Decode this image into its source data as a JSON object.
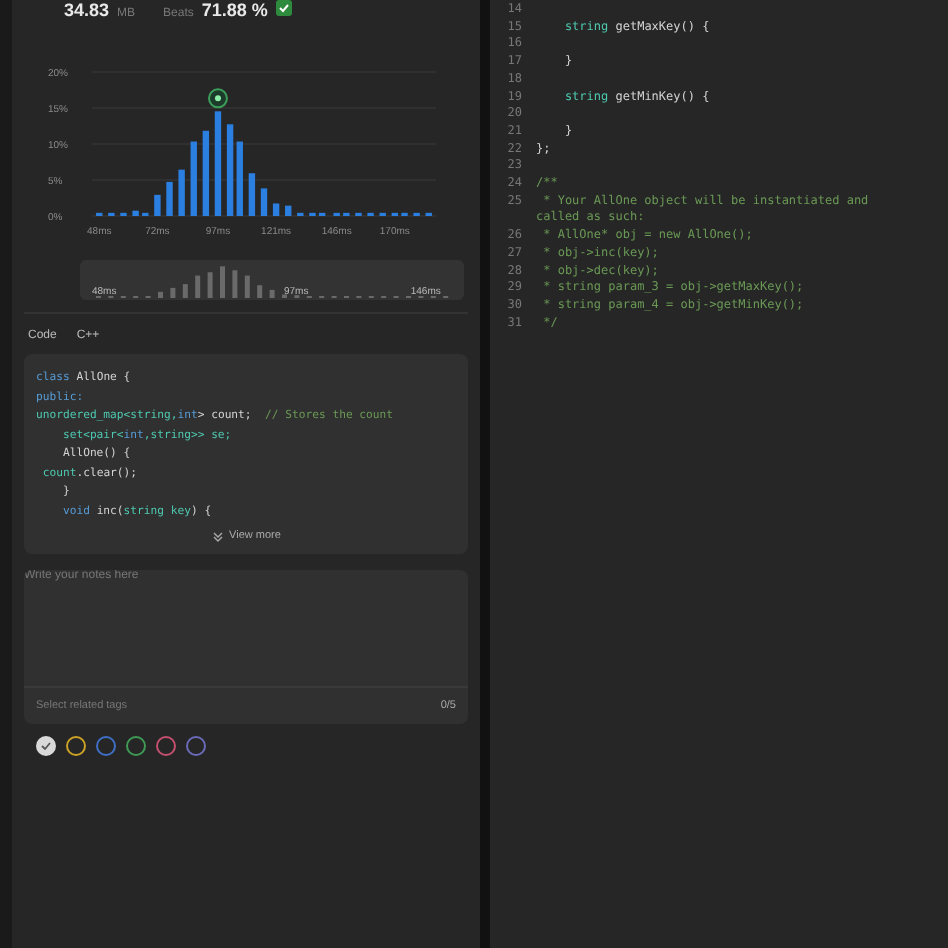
{
  "memory": {
    "value": "34.83",
    "unit": "MB",
    "beats_label": "Beats",
    "beats_value": "71.88 %"
  },
  "chart": {
    "chart_data": {
      "type": "bar",
      "grid": true,
      "xlim": [
        45,
        187
      ],
      "x": [
        48,
        53,
        58,
        63,
        67,
        72,
        77,
        82,
        87,
        92,
        97,
        102,
        106,
        111,
        116,
        121,
        126,
        131,
        136,
        140,
        146,
        150,
        155,
        160,
        165,
        170,
        174,
        179,
        184
      ],
      "values": [
        0.3,
        0.3,
        0.3,
        0.6,
        0.3,
        2.8,
        4.6,
        6.3,
        10.2,
        11.7,
        14.4,
        12.6,
        10.2,
        5.8,
        3.7,
        1.6,
        1.3,
        0.3,
        0.3,
        0.3,
        0.3,
        0.3,
        0.3,
        0.3,
        0.3,
        0.3,
        0.3,
        0.3,
        0.3
      ],
      "ylim": [
        0,
        20
      ],
      "yticks": [
        {
          "value": 0,
          "label": "0%"
        },
        {
          "value": 5,
          "label": "5%"
        },
        {
          "value": 10,
          "label": "10%"
        },
        {
          "value": 15,
          "label": "15%"
        },
        {
          "value": 20,
          "label": "20%"
        }
      ],
      "xticks": [
        {
          "value": 48,
          "label": "48ms"
        },
        {
          "value": 72,
          "label": "72ms"
        },
        {
          "value": 97,
          "label": "97ms"
        },
        {
          "value": 121,
          "label": "121ms"
        },
        {
          "value": 146,
          "label": "146ms"
        },
        {
          "value": 170,
          "label": "170ms"
        }
      ]
    },
    "overview_labels": [
      "48ms",
      "97ms",
      "146ms"
    ]
  },
  "code_card": {
    "tabs": [
      "Code",
      "C++"
    ],
    "view_more": "View more",
    "lines": [
      [
        {
          "text": "class ",
          "kind": "keyword"
        },
        {
          "text": "AllOne {",
          "kind": "plain"
        }
      ],
      [
        {
          "text": "public:",
          "kind": "keyword"
        }
      ],
      [
        {
          "text": "unordered_map<string,",
          "kind": "type"
        },
        {
          "text": "int",
          "kind": "keyword"
        },
        {
          "text": "> count;  ",
          "kind": "plain"
        },
        {
          "text": "// Stores the count",
          "kind": "comment"
        }
      ],
      [
        {
          "text": "    set<pair<",
          "kind": "type"
        },
        {
          "text": "int",
          "kind": "keyword"
        },
        {
          "text": ",string>> se;",
          "kind": "type"
        }
      ],
      [
        {
          "text": "    AllOne() {",
          "kind": "plain"
        }
      ],
      [
        {
          "text": " count",
          "kind": "type"
        },
        {
          "text": ".clear();",
          "kind": "plain"
        }
      ],
      [
        {
          "text": "    }",
          "kind": "plain"
        }
      ],
      [
        {
          "text": "    void ",
          "kind": "keyword"
        },
        {
          "text": "inc(",
          "kind": "plain"
        },
        {
          "text": "string key",
          "kind": "type"
        },
        {
          "text": ") {",
          "kind": "plain"
        }
      ]
    ]
  },
  "notes": {
    "placeholder": "Write your notes here",
    "tags_placeholder": "Select related tags",
    "tag_count": "0/5",
    "colors": [
      {
        "color": "#d9d9d9",
        "selected": true
      },
      {
        "color": "#c9a227",
        "selected": false
      },
      {
        "color": "#3e6fc4",
        "selected": false
      },
      {
        "color": "#3f9a55",
        "selected": false
      },
      {
        "color": "#c2506e",
        "selected": false
      },
      {
        "color": "#6a6ab8",
        "selected": false
      }
    ]
  },
  "editor": {
    "lines": [
      {
        "number": "14"
      },
      {
        "number": "15",
        "segs": [
          {
            "text": "    string ",
            "kind": "type"
          },
          {
            "text": "getMaxKey() {",
            "kind": "plain"
          }
        ]
      },
      {
        "number": "16"
      },
      {
        "number": "17",
        "segs": [
          {
            "text": "    }",
            "kind": "plain"
          }
        ]
      },
      {
        "number": "18"
      },
      {
        "number": "19",
        "segs": [
          {
            "text": "    string ",
            "kind": "type"
          },
          {
            "text": "getMinKey() {",
            "kind": "plain"
          }
        ]
      },
      {
        "number": "20"
      },
      {
        "number": "21",
        "segs": [
          {
            "text": "    }",
            "kind": "plain"
          }
        ]
      },
      {
        "number": "22",
        "segs": [
          {
            "text": "};",
            "kind": "plain"
          }
        ]
      },
      {
        "number": "23"
      },
      {
        "number": "24",
        "segs": [
          {
            "text": "/**",
            "kind": "comment"
          }
        ]
      },
      {
        "number": "25",
        "segs": [
          {
            "text": " * Your AllOne object will be instantiated and",
            "kind": "comment"
          }
        ]
      },
      {
        "segs": [
          {
            "text": "called as such:",
            "kind": "comment"
          }
        ]
      },
      {
        "number": "26",
        "segs": [
          {
            "text": " * AllOne* obj = new AllOne();",
            "kind": "comment"
          }
        ]
      },
      {
        "number": "27",
        "segs": [
          {
            "text": " * obj->inc(key);",
            "kind": "comment"
          }
        ]
      },
      {
        "number": "28",
        "segs": [
          {
            "text": " * obj->dec(key);",
            "kind": "comment"
          }
        ]
      },
      {
        "number": "29",
        "segs": [
          {
            "text": " * string param_3 = obj->getMaxKey();",
            "kind": "comment"
          }
        ]
      },
      {
        "number": "30",
        "segs": [
          {
            "text": " * string param_4 = obj->getMinKey();",
            "kind": "comment"
          }
        ]
      },
      {
        "number": "31",
        "segs": [
          {
            "text": " */",
            "kind": "comment"
          }
        ]
      }
    ]
  }
}
